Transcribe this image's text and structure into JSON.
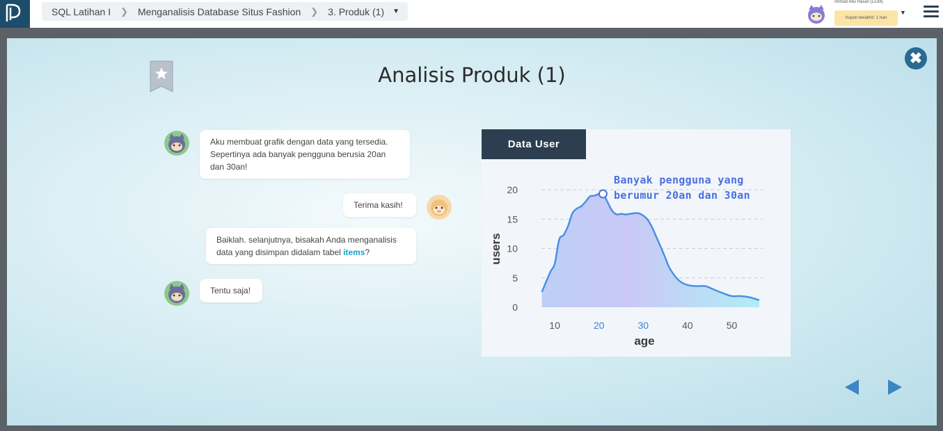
{
  "breadcrumb": {
    "course": "SQL Latihan I",
    "chapter": "Menganalisis Database Situs Fashion",
    "lesson": "3. Produk (1)"
  },
  "user": {
    "name": "Ahmad Abu Hasan (Lv.84)",
    "coupon": "Kupon berakhir: 1 hari"
  },
  "modal": {
    "title": "Analisis Produk (1)"
  },
  "chat": [
    {
      "side": "left",
      "text": "Aku membuat grafik dengan data yang tersedia. Sepertinya ada banyak pengguna berusia 20an dan 30an!"
    },
    {
      "side": "right",
      "text": "Terima kasih!"
    },
    {
      "side": "left",
      "text_before": "Baiklah. selanjutnya, bisakah Anda menganalisis data yang disimpan didalam tabel ",
      "highlight": "items",
      "text_after": "?"
    },
    {
      "side": "left",
      "text": "Tentu saja!"
    }
  ],
  "chart_tab": "Data User",
  "chart_data": {
    "type": "area",
    "xlabel": "age",
    "ylabel": "users",
    "xlim": [
      7,
      57
    ],
    "ylim": [
      0,
      20
    ],
    "x_ticks": [
      10,
      20,
      30,
      40,
      50
    ],
    "y_ticks": [
      0,
      5,
      10,
      15,
      20
    ],
    "highlight_ticks": [
      20,
      30
    ],
    "grid": "horizontal-dashed",
    "annotation": {
      "line1": "Banyak pengguna yang",
      "line2": "berumur 20an dan 30an",
      "x": 20.9,
      "y": 19.3
    },
    "x": [
      7.1,
      9,
      10,
      11,
      12,
      13,
      14,
      15,
      16,
      17,
      18,
      19,
      20,
      21,
      22,
      23,
      24,
      25,
      26,
      27,
      28,
      29,
      30,
      31,
      32,
      33,
      34,
      35,
      36,
      38,
      40,
      42,
      44,
      46,
      48,
      50,
      52,
      54,
      56.2
    ],
    "y": [
      2.6,
      6.0,
      7.4,
      11.5,
      12.3,
      13.8,
      16.0,
      16.8,
      17.2,
      18.0,
      18.9,
      19.0,
      19.3,
      19.2,
      17.8,
      16.4,
      15.8,
      15.9,
      15.8,
      15.9,
      16.0,
      16.0,
      15.6,
      14.9,
      13.6,
      11.9,
      10.2,
      8.4,
      6.6,
      4.6,
      3.8,
      3.6,
      3.6,
      3.0,
      2.4,
      1.9,
      1.9,
      1.7,
      1.2
    ],
    "colors": {
      "line": "#4a90e2",
      "fill_start": "#b7cbf5",
      "fill_mid": "#c5c3f6",
      "fill_end": "#a9ecf4",
      "annotation": "#4a6fe0",
      "highlight_tick": "#3b7fd6"
    }
  }
}
